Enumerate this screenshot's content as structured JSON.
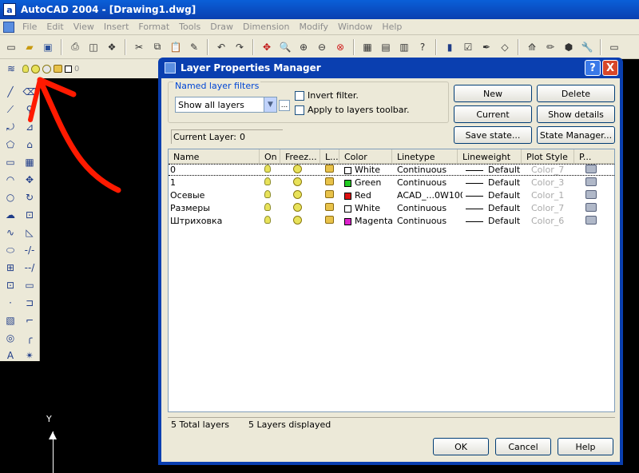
{
  "app": {
    "title": "AutoCAD 2004 - [Drawing1.dwg]",
    "icon_letter": "a"
  },
  "menu": [
    "File",
    "Edit",
    "View",
    "Insert",
    "Format",
    "Tools",
    "Draw",
    "Dimension",
    "Modify",
    "Window",
    "Help"
  ],
  "layer_toolbar": {
    "current": "0"
  },
  "ucs": {
    "y_label": "Y"
  },
  "dialog": {
    "title": "Layer Properties Manager",
    "help_label": "?",
    "close_label": "X",
    "named_filters_label": "Named layer filters",
    "filter_select": "Show all layers",
    "filter_more": "...",
    "invert_filter": "Invert filter.",
    "apply_toolbar": "Apply to layers toolbar.",
    "buttons": {
      "new": "New",
      "delete": "Delete",
      "current": "Current",
      "show_details": "Show details",
      "save_state": "Save state...",
      "state_manager": "State Manager...",
      "ok": "OK",
      "cancel": "Cancel",
      "help": "Help"
    },
    "current_layer_label": "Current Layer:",
    "current_layer_value": "0",
    "columns": [
      "Name",
      "On",
      "Freez...",
      "L...",
      "Color",
      "Linetype",
      "Lineweight",
      "Plot Style",
      "P..."
    ],
    "layers": [
      {
        "name": "0",
        "color_name": "White",
        "color_hex": "#ffffff",
        "linetype": "Continuous",
        "lineweight": "Default",
        "plot_style": "Color_7"
      },
      {
        "name": "1",
        "color_name": "Green",
        "color_hex": "#22cc22",
        "linetype": "Continuous",
        "lineweight": "Default",
        "plot_style": "Color_3"
      },
      {
        "name": "Осевые",
        "color_name": "Red",
        "color_hex": "#dd1111",
        "linetype": "ACAD_...0W100",
        "lineweight": "Default",
        "plot_style": "Color_1"
      },
      {
        "name": "Размеры",
        "color_name": "White",
        "color_hex": "#ffffff",
        "linetype": "Continuous",
        "lineweight": "Default",
        "plot_style": "Color_7"
      },
      {
        "name": "Штриховка",
        "color_name": "Magenta",
        "color_hex": "#dd22cc",
        "linetype": "Continuous",
        "lineweight": "Default",
        "plot_style": "Color_6"
      }
    ],
    "status_total": "5 Total layers",
    "status_displayed": "5 Layers displayed"
  }
}
